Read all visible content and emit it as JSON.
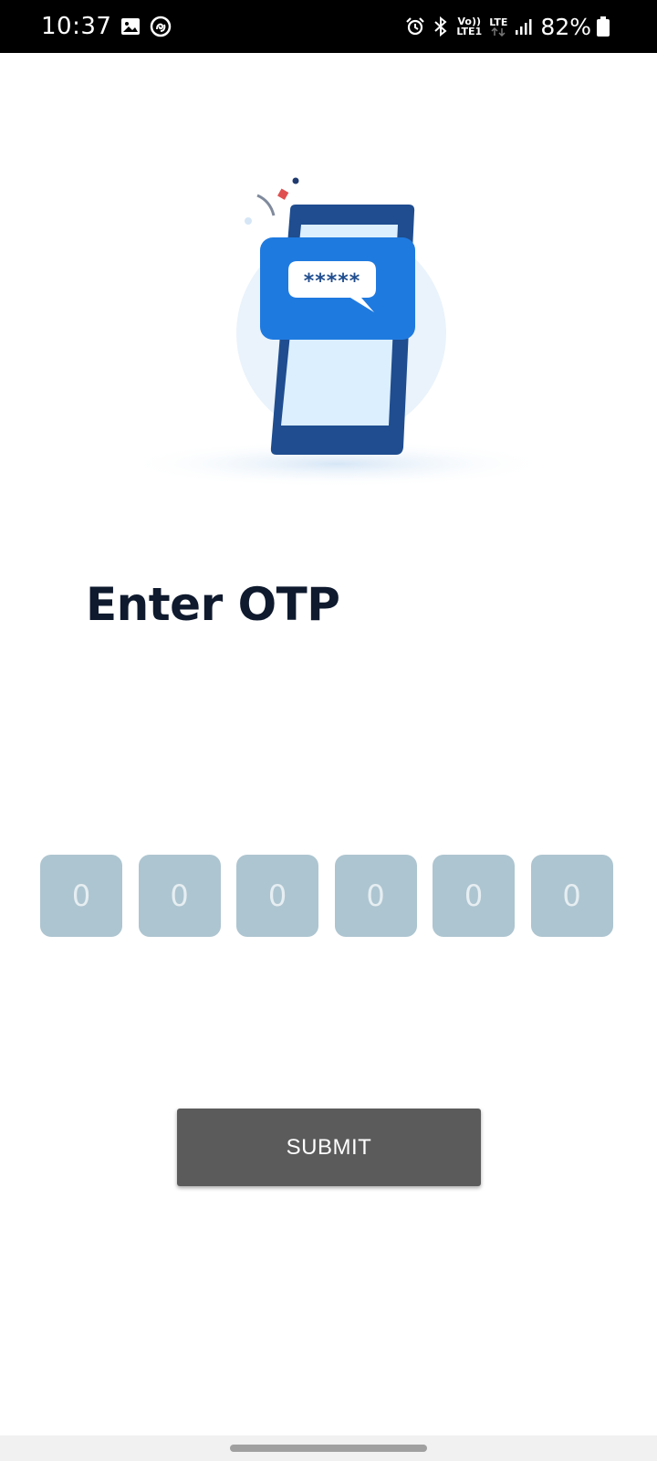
{
  "status_bar": {
    "time": "10:37",
    "net_top": "Vo))",
    "net_bottom": "LTE1",
    "lte_label": "LTE",
    "battery": "82%",
    "icons": [
      "image-icon",
      "sync-app-icon",
      "alarm-icon",
      "bluetooth-icon",
      "volte-icon",
      "lte-icon",
      "signal-icon",
      "battery-icon"
    ]
  },
  "illustration": {
    "icon": "otp-phone-illustration",
    "message_mask": "*****",
    "colors": {
      "phone": "#1f4d8f",
      "card": "#1f7ae0",
      "screen": "#dcefff",
      "halo": "#eaf3fb"
    }
  },
  "main": {
    "title": "Enter OTP",
    "otp_digits": [
      "0",
      "0",
      "0",
      "0",
      "0",
      "0"
    ],
    "submit_label": "SUBMIT"
  },
  "colors": {
    "otp_box": "#adc5d0",
    "button": "#5b5b5b",
    "title": "#0f1a2e"
  }
}
